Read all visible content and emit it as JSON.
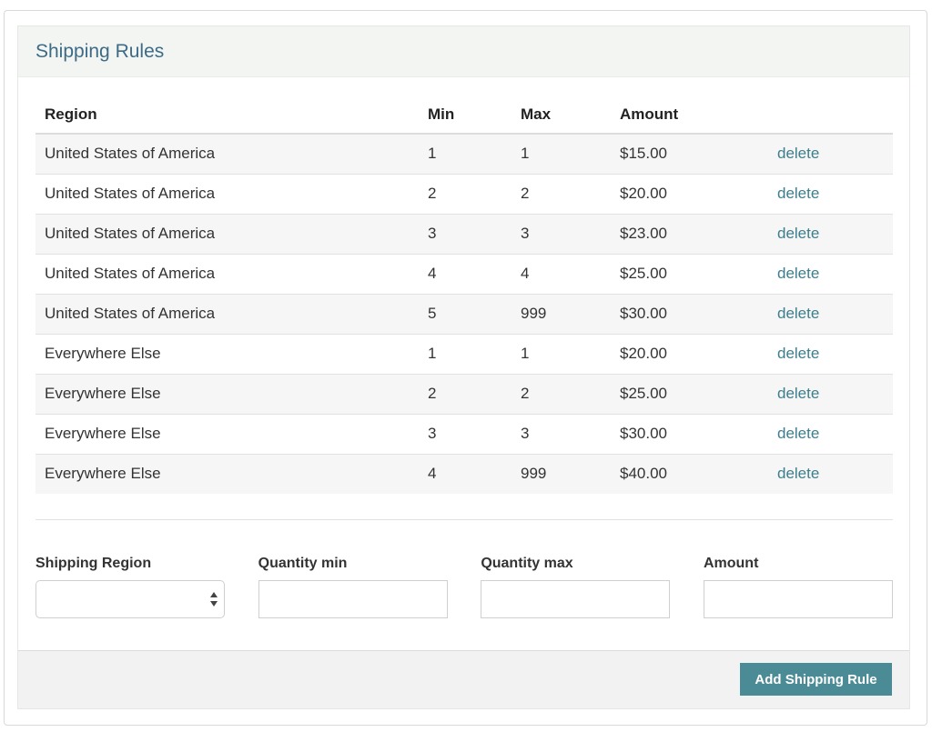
{
  "panel": {
    "title": "Shipping Rules"
  },
  "table": {
    "headers": {
      "region": "Region",
      "min": "Min",
      "max": "Max",
      "amount": "Amount"
    },
    "rows": [
      {
        "region": "United States of America",
        "min": "1",
        "max": "1",
        "amount": "$15.00",
        "action": "delete"
      },
      {
        "region": "United States of America",
        "min": "2",
        "max": "2",
        "amount": "$20.00",
        "action": "delete"
      },
      {
        "region": "United States of America",
        "min": "3",
        "max": "3",
        "amount": "$23.00",
        "action": "delete"
      },
      {
        "region": "United States of America",
        "min": "4",
        "max": "4",
        "amount": "$25.00",
        "action": "delete"
      },
      {
        "region": "United States of America",
        "min": "5",
        "max": "999",
        "amount": "$30.00",
        "action": "delete"
      },
      {
        "region": "Everywhere Else",
        "min": "1",
        "max": "1",
        "amount": "$20.00",
        "action": "delete"
      },
      {
        "region": "Everywhere Else",
        "min": "2",
        "max": "2",
        "amount": "$25.00",
        "action": "delete"
      },
      {
        "region": "Everywhere Else",
        "min": "3",
        "max": "3",
        "amount": "$30.00",
        "action": "delete"
      },
      {
        "region": "Everywhere Else",
        "min": "4",
        "max": "999",
        "amount": "$40.00",
        "action": "delete"
      }
    ]
  },
  "form": {
    "shipping_region": {
      "label": "Shipping Region",
      "value": ""
    },
    "quantity_min": {
      "label": "Quantity min",
      "value": ""
    },
    "quantity_max": {
      "label": "Quantity max",
      "value": ""
    },
    "amount": {
      "label": "Amount",
      "value": ""
    }
  },
  "footer": {
    "add_button_label": "Add Shipping Rule"
  },
  "colors": {
    "title": "#3d6b86",
    "link": "#3d7e8c",
    "button": "#4a8b96"
  },
  "icons": {
    "select_arrows": "up-down-arrows-icon"
  }
}
